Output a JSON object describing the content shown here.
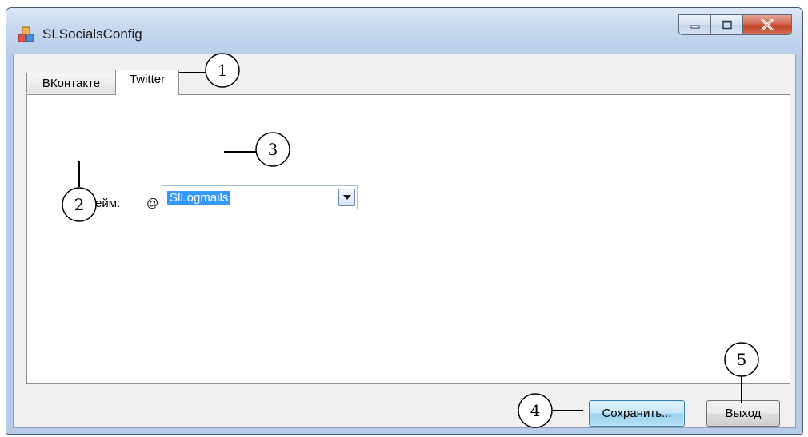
{
  "window": {
    "title": "SLSocialsConfig"
  },
  "tabs": [
    {
      "label": "ВКонтакте",
      "active": false
    },
    {
      "label": "Twitter",
      "active": true
    }
  ],
  "form": {
    "nickname_label": "Никнейм:",
    "at_symbol": "@",
    "nickname_value": "SlLogmails"
  },
  "buttons": {
    "save_label": "Сохранить...",
    "exit_label": "Выход"
  },
  "callouts": [
    "1",
    "2",
    "3",
    "4",
    "5"
  ],
  "colors": {
    "selection": "#3399ff",
    "close_button": "#c0401f",
    "focus_button": "#98d1ef"
  }
}
